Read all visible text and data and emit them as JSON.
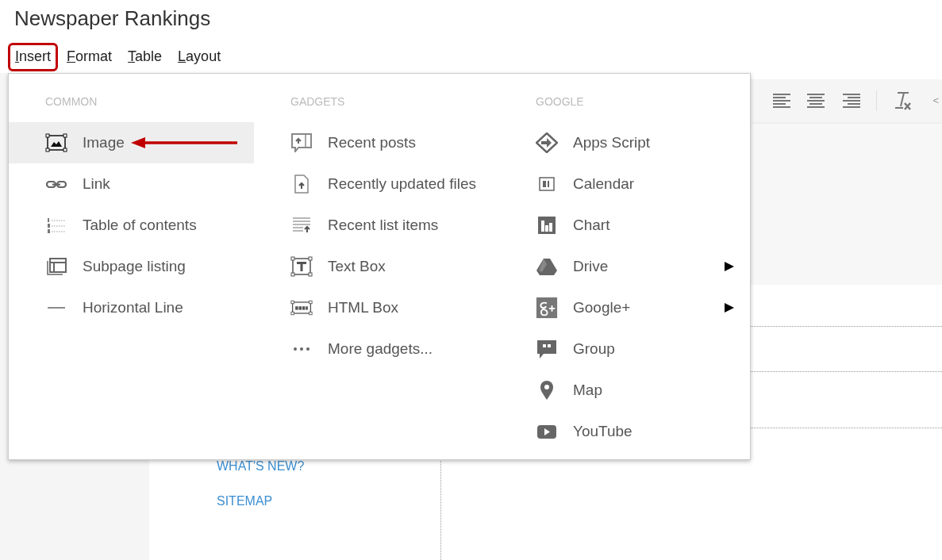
{
  "page_title": "Newspaper Rankings",
  "menubar": [
    {
      "label": "Insert",
      "callout": true
    },
    {
      "label": "Format",
      "callout": false
    },
    {
      "label": "Table",
      "callout": false
    },
    {
      "label": "Layout",
      "callout": false
    }
  ],
  "insert_menu": {
    "columns": [
      {
        "heading": "COMMON",
        "items": [
          {
            "label": "Image",
            "selected": true,
            "has_submenu": false,
            "pointer_arrow": true
          },
          {
            "label": "Link",
            "selected": false,
            "has_submenu": false,
            "pointer_arrow": false
          },
          {
            "label": "Table of contents",
            "selected": false,
            "has_submenu": false,
            "pointer_arrow": false
          },
          {
            "label": "Subpage listing",
            "selected": false,
            "has_submenu": false,
            "pointer_arrow": false
          },
          {
            "label": "Horizontal Line",
            "selected": false,
            "has_submenu": false,
            "pointer_arrow": false
          }
        ]
      },
      {
        "heading": "GADGETS",
        "items": [
          {
            "label": "Recent posts",
            "selected": false,
            "has_submenu": false,
            "pointer_arrow": false
          },
          {
            "label": "Recently updated files",
            "selected": false,
            "has_submenu": false,
            "pointer_arrow": false
          },
          {
            "label": "Recent list items",
            "selected": false,
            "has_submenu": false,
            "pointer_arrow": false
          },
          {
            "label": "Text Box",
            "selected": false,
            "has_submenu": false,
            "pointer_arrow": false
          },
          {
            "label": "HTML Box",
            "selected": false,
            "has_submenu": false,
            "pointer_arrow": false
          },
          {
            "label": "More gadgets...",
            "selected": false,
            "has_submenu": false,
            "pointer_arrow": false
          }
        ]
      },
      {
        "heading": "GOOGLE",
        "items": [
          {
            "label": "Apps Script",
            "selected": false,
            "has_submenu": false,
            "pointer_arrow": false
          },
          {
            "label": "Calendar",
            "selected": false,
            "has_submenu": false,
            "pointer_arrow": false
          },
          {
            "label": "Chart",
            "selected": false,
            "has_submenu": false,
            "pointer_arrow": false
          },
          {
            "label": "Drive",
            "selected": false,
            "has_submenu": true,
            "pointer_arrow": false
          },
          {
            "label": "Google+",
            "selected": false,
            "has_submenu": true,
            "pointer_arrow": false
          },
          {
            "label": "Group",
            "selected": false,
            "has_submenu": false,
            "pointer_arrow": false
          },
          {
            "label": "Map",
            "selected": false,
            "has_submenu": false,
            "pointer_arrow": false
          },
          {
            "label": "YouTube",
            "selected": false,
            "has_submenu": false,
            "pointer_arrow": false
          }
        ]
      }
    ]
  },
  "toolbar": {
    "html_button": "<"
  },
  "sidebar_links": [
    "WHAT'S NEW?",
    "SITEMAP"
  ]
}
